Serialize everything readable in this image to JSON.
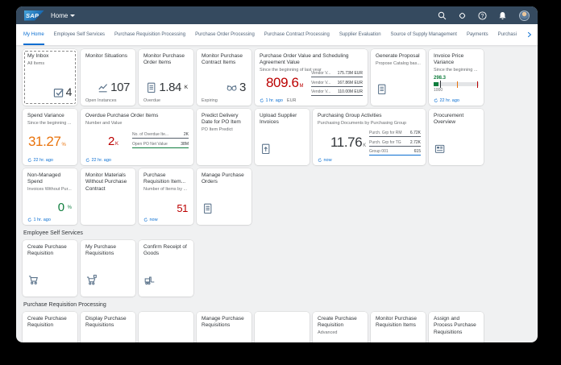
{
  "shell": {
    "logo": "SAP",
    "title": "Home",
    "icons": [
      "search-icon",
      "copilot-icon",
      "help-icon",
      "notifications-icon",
      "avatar"
    ]
  },
  "tabs": {
    "selected": "My Home",
    "items": [
      "My Home",
      "Employee Self Services",
      "Purchase Requisition Processing",
      "Purchase Order Processing",
      "Purchase Contract Processing",
      "Supplier Evaluation",
      "Source of Supply Management",
      "Payments",
      "Purchasi"
    ],
    "overflow_icons": [
      "chevron-right-icon",
      "chevron-down-icon"
    ]
  },
  "colors": {
    "shell_bg": "#354a5f",
    "accent": "#0a6ed1",
    "negative": "#bb0000",
    "critical": "#e9730c",
    "positive": "#107e3e",
    "neutral": "#32363a"
  },
  "sections": {
    "ess_heading": "Employee Self Services",
    "prp_heading": "Purchase Requisition Processing"
  },
  "tiles": {
    "my_inbox": {
      "title": "My Inbox",
      "subtitle": "All Items",
      "value": "4",
      "icon": "inbox-check-icon"
    },
    "monitor_situations": {
      "title": "Monitor Situations",
      "value": "107",
      "footer": "Open Instances",
      "icon": "line-chart-icon"
    },
    "monitor_po_items": {
      "title": "Monitor Purchase Order Items",
      "value": "1.84",
      "unit": "K",
      "footer": "Overdue",
      "icon": "document-icon"
    },
    "monitor_pc_items": {
      "title": "Monitor Purchase Contract Items",
      "value": "3",
      "footer": "Expiring",
      "icon": "handshake-icon"
    },
    "po_value": {
      "title": "Purchase Order Value and Scheduling Agreement Value",
      "subtitle": "Since the beginning of last year",
      "value": "809.6",
      "unit": "M",
      "time": "1 hr. ago",
      "currency": "EUR",
      "list": [
        {
          "label": "Vendor V...",
          "value": "175.73M EUR"
        },
        {
          "label": "Vendor V...",
          "value": "167.86M EUR"
        },
        {
          "label": "Vendor V...",
          "value": "110.00M EUR"
        }
      ]
    },
    "generate_proposal": {
      "title": "Generate Proposal",
      "subtitle": "Propose Catalog bas...",
      "icon": "catalog-icon"
    },
    "invoice_price_variance": {
      "title": "Invoice Price Variance",
      "subtitle": "Since the beginning ...",
      "value": "298.3",
      "scale": "1000",
      "time": "22 hr. ago"
    },
    "spend_variance": {
      "title": "Spend Variance",
      "subtitle": "Since the beginning ...",
      "value": "31.27",
      "unit": "%",
      "time": "22 hr. ago"
    },
    "overdue_po": {
      "title": "Overdue Purchase Order Items",
      "subtitle": "Number and Value",
      "value": "2",
      "unit": "K",
      "time": "22 hr. ago",
      "list": [
        {
          "label": "No. of Overdue Ite...",
          "value": "2K"
        },
        {
          "label": "Open PO Net Value",
          "value": "38M"
        }
      ]
    },
    "predict_delivery": {
      "title": "Predict Delivery Date for PO Item",
      "subtitle": "PO Item Predict"
    },
    "upload_invoices": {
      "title": "Upload Supplier Invoices",
      "icon": "upload-document-icon"
    },
    "purchasing_group": {
      "title": "Purchasing Group Activities",
      "subtitle": "Purchasing Documents by Purchasing Group",
      "value": "11.76",
      "unit": "K",
      "time": "now",
      "list": [
        {
          "label": "Purch. Grp for RM",
          "value": "6.72K"
        },
        {
          "label": "Purch. Grp for TG",
          "value": "2.72K"
        },
        {
          "label": "Group 001",
          "value": "615"
        }
      ]
    },
    "procurement_overview": {
      "title": "Procurement Overview",
      "icon": "news-icon"
    },
    "non_managed_spend": {
      "title": "Non-Managed Spend",
      "subtitle": "Invoices Without Pur...",
      "value": "0",
      "unit": "%",
      "time": "1 hr. ago"
    },
    "monitor_materials": {
      "title": "Monitor Materials Without Purchase Contract"
    },
    "pr_items": {
      "title": "Purchase Requisition Item...",
      "subtitle": "Number of Items by ...",
      "value": "51",
      "time": "now"
    },
    "manage_po": {
      "title": "Manage Purchase Orders",
      "icon": "order-document-icon"
    },
    "ess_create_pr": {
      "title": "Create Purchase Requisition",
      "icon": "cart-icon"
    },
    "ess_my_pr": {
      "title": "My Purchase Requisitions",
      "icon": "cart-badge-icon"
    },
    "ess_confirm": {
      "title": "Confirm Receipt of Goods",
      "icon": "forklift-icon"
    },
    "prp_create": {
      "title": "Create Purchase Requisition"
    },
    "prp_display": {
      "title": "Display Purchase Requisitions"
    },
    "prp_blank1": {
      "title": ""
    },
    "prp_manage": {
      "title": "Manage Purchase Requisitions"
    },
    "prp_blank2": {
      "title": ""
    },
    "prp_create_adv": {
      "title": "Create Purchase Requisition",
      "subtitle": "Advanced"
    },
    "prp_monitor": {
      "title": "Monitor Purchase Requisition Items"
    },
    "prp_assign": {
      "title": "Assign and Process Purchase Requisitions"
    }
  }
}
